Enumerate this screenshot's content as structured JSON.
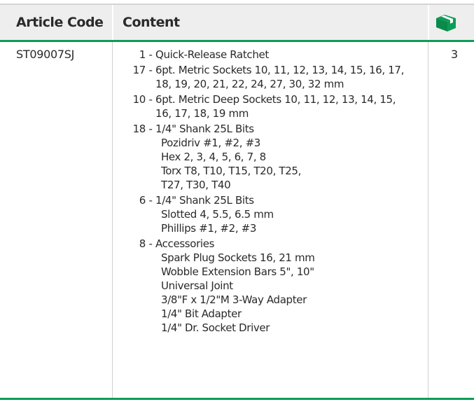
{
  "colors": {
    "header_bg": "#eeeeee",
    "accent_green": "#0d9c55",
    "text": "#2a2a2a"
  },
  "header": {
    "article_code_label": "Article Code",
    "content_label": "Content",
    "quantity_icon": "box-icon"
  },
  "row": {
    "article_code": "ST09007SJ",
    "quantity": "3",
    "items": [
      {
        "count": "1",
        "lines": [
          "Quick-Release Ratchet"
        ]
      },
      {
        "count": "17",
        "lines": [
          "6pt. Metric Sockets 10, 11, 12, 13, 14, 15, 16, 17,",
          "18, 19, 20, 21, 22, 24, 27, 30, 32 mm"
        ]
      },
      {
        "count": "10",
        "lines": [
          "6pt. Metric Deep Sockets 10, 11, 12, 13, 14, 15,",
          "16, 17, 18, 19 mm"
        ]
      },
      {
        "count": "18",
        "lines": [
          "1/4\" Shank 25L Bits"
        ],
        "sub": [
          "Pozidriv #1, #2, #3",
          "Hex 2, 3, 4, 5, 6, 7, 8",
          "Torx T8, T10, T15, T20, T25,",
          "T27, T30, T40"
        ]
      },
      {
        "count": "6",
        "lines": [
          "1/4\" Shank 25L Bits"
        ],
        "sub": [
          "Slotted 4, 5.5, 6.5 mm",
          "Phillips #1, #2, #3"
        ]
      },
      {
        "count": "8",
        "lines": [
          "Accessories"
        ],
        "sub": [
          "Spark Plug Sockets 16, 21 mm",
          "Wobble Extension Bars 5\", 10\"",
          "Universal Joint",
          "3/8\"F x 1/2\"M 3-Way Adapter",
          "1/4\" Bit Adapter",
          "1/4\" Dr. Socket Driver"
        ]
      }
    ]
  }
}
